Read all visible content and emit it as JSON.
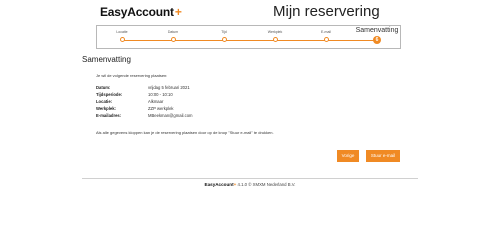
{
  "header": {
    "logo_text": "EasyAccount",
    "logo_plus": "+",
    "title": "Mijn reservering"
  },
  "stepper": {
    "steps": [
      {
        "label": "Locatie",
        "number": ""
      },
      {
        "label": "Datum",
        "number": ""
      },
      {
        "label": "Tijd",
        "number": ""
      },
      {
        "label": "Werkplek",
        "number": ""
      },
      {
        "label": "E-mail",
        "number": ""
      },
      {
        "label": "Samenvatting",
        "number": "6"
      }
    ],
    "active_index": 5
  },
  "summary": {
    "title": "Samenvatting",
    "intro": "Je wil de volgende reservering plaatsen:",
    "rows": [
      {
        "label": "Datum:",
        "value": "vrijdag 5 februari 2021"
      },
      {
        "label": "Tijdsperiode:",
        "value": "10:00 - 10:10"
      },
      {
        "label": "Locatie:",
        "value": "Alkmaar"
      },
      {
        "label": "Werkplek:",
        "value": "ZZP werkplek"
      },
      {
        "label": "E-mailadres:",
        "value": "MBeekman@gmail.com"
      }
    ],
    "note": "Als alle gegevens kloppen kan je de reservering plaatsen door op de knop \"Stuur e-mail\" te drukken."
  },
  "buttons": {
    "back": "Vorige",
    "send": "Stuur e-mail"
  },
  "footer": {
    "logo_text": "EasyAccount",
    "logo_plus": "+",
    "text": "4.1.0 © XMXM Nederland B.V."
  },
  "colors": {
    "accent": "#f08a24"
  }
}
